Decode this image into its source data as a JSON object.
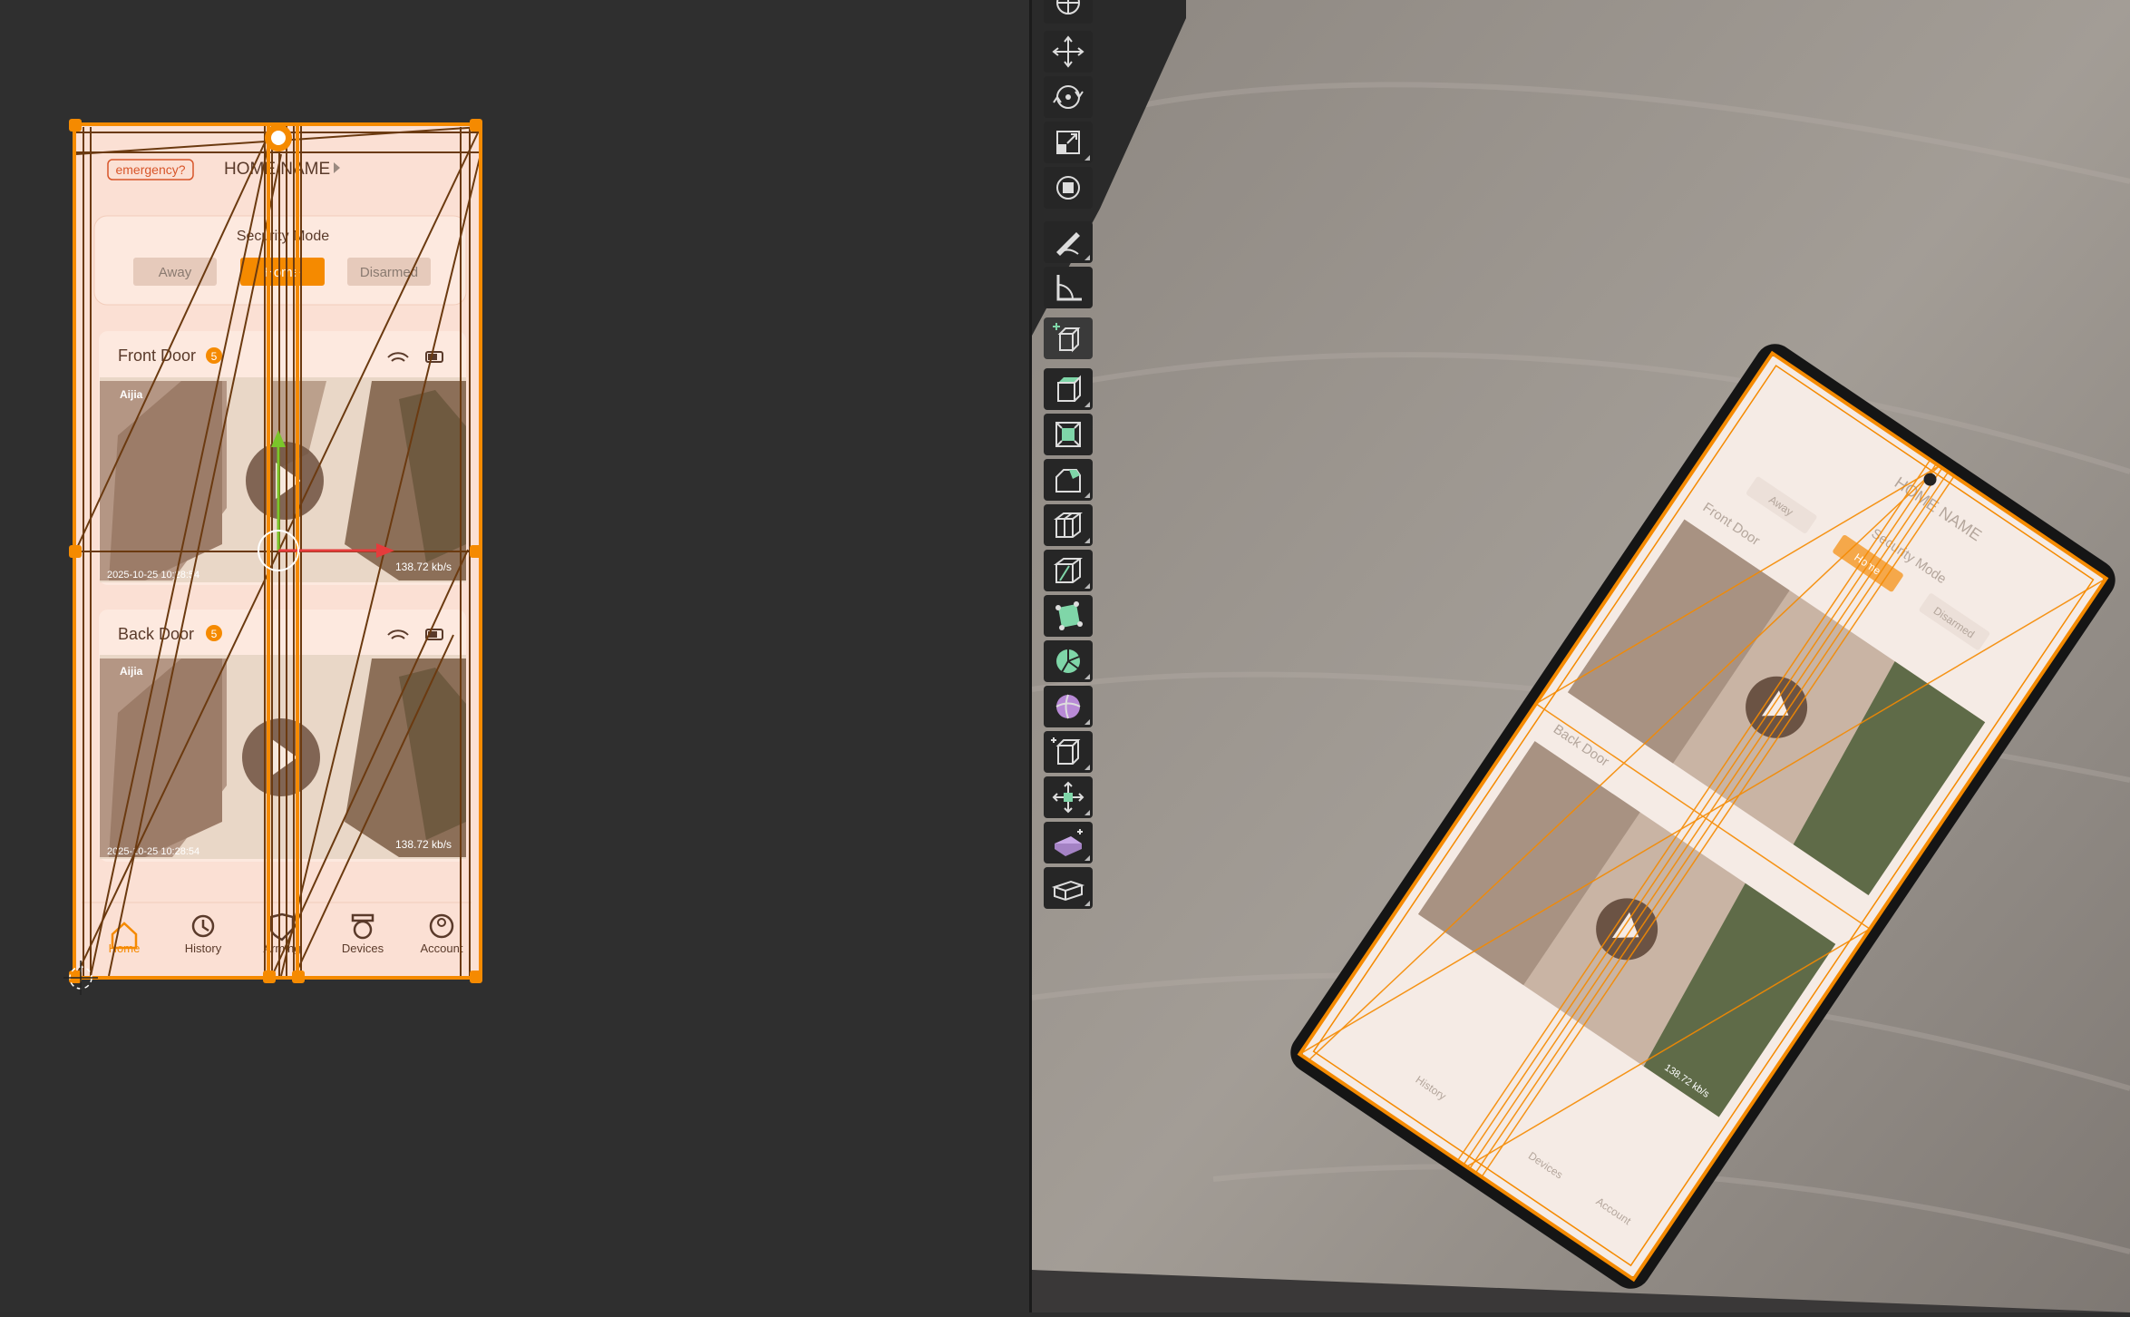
{
  "uv_panel": {
    "phone_ui": {
      "emergency_label": "emergency?",
      "home_name": "HOME NAME",
      "security_mode": {
        "title": "Security Mode",
        "options": [
          "Away",
          "Home",
          "Disarmed"
        ],
        "selected": "Home"
      },
      "cameras": [
        {
          "name": "Front Door",
          "badge": "5",
          "brand": "Aijia",
          "timestamp": "2025-10-25 10:28:54",
          "speed": "138.72 kb/s"
        },
        {
          "name": "Back Door",
          "badge": "5",
          "brand": "Aijia",
          "timestamp": "2025-10-25 10:28:54",
          "speed": "138.72 kb/s"
        }
      ],
      "nav": [
        {
          "label": "Home",
          "active": true,
          "icon": "home-icon"
        },
        {
          "label": "History",
          "active": false,
          "icon": "history-icon"
        },
        {
          "label": "Arming",
          "active": false,
          "icon": "shield-icon"
        },
        {
          "label": "Devices",
          "active": false,
          "icon": "camera-icon"
        },
        {
          "label": "Account",
          "active": false,
          "icon": "user-icon"
        }
      ]
    }
  },
  "viewport_phone": {
    "home_name": "HOME NAME",
    "security_mode": "Security Mode",
    "mode_options": [
      "Away",
      "Home",
      "Disarmed"
    ],
    "cam1_name": "Front Door",
    "cam2_name": "Back Door",
    "speed": "138.72 kb/s",
    "nav": [
      "History",
      "Devices",
      "Account"
    ]
  },
  "colors": {
    "accent": "#f58a00",
    "edge": "#6b3a10",
    "uv_fill": "#fbe0d4",
    "background": "#2f2f2f",
    "toolbar": "#262626"
  },
  "toolbar": {
    "tools": [
      {
        "icon": "transform-gizmo-icon",
        "active": false
      },
      {
        "icon": "move-icon",
        "active": false
      },
      {
        "icon": "rotate-icon",
        "active": false
      },
      {
        "icon": "scale-icon",
        "active": false
      },
      {
        "icon": "transform-icon",
        "active": false
      },
      {
        "icon": "annotate-icon",
        "active": false
      },
      {
        "icon": "measure-icon",
        "active": false
      },
      {
        "icon": "add-cube-icon",
        "active": true
      },
      {
        "icon": "extrude-region-icon",
        "active": false
      },
      {
        "icon": "inset-faces-icon",
        "active": false
      },
      {
        "icon": "bevel-icon",
        "active": false
      },
      {
        "icon": "loop-cut-icon",
        "active": false
      },
      {
        "icon": "knife-icon",
        "active": false
      },
      {
        "icon": "poly-build-icon",
        "active": false
      },
      {
        "icon": "spin-icon",
        "active": false
      },
      {
        "icon": "smooth-icon",
        "active": false
      },
      {
        "icon": "edge-slide-icon",
        "active": false
      },
      {
        "icon": "shrink-fatten-icon",
        "active": false
      },
      {
        "icon": "shear-icon",
        "active": false
      },
      {
        "icon": "rip-region-icon",
        "active": false
      }
    ]
  }
}
